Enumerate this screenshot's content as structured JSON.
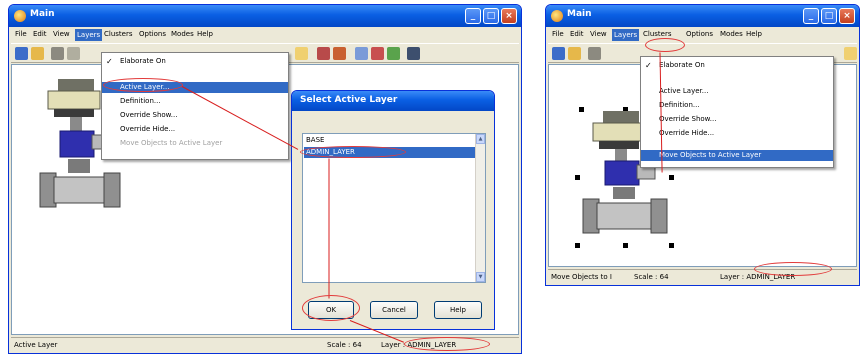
{
  "left_window": {
    "title": "Main",
    "menu": [
      "File",
      "Edit",
      "View",
      "Layers",
      "Clusters",
      "Options",
      "Modes",
      "Help"
    ],
    "layers_menu": {
      "elaborate_on": "Elaborate On",
      "active_layer": "Active Layer...",
      "definition": "Definition...",
      "override_show": "Override Show...",
      "override_hide": "Override Hide...",
      "move_objects": "Move Objects to Active Layer"
    },
    "status": {
      "left": "Active Layer",
      "scale": "Scale : 64",
      "layer": "Layer : ADMIN_LAYER"
    },
    "dialog": {
      "title": "Select Active Layer",
      "items": [
        "BASE",
        "ADMIN_LAYER"
      ],
      "ok": "OK",
      "cancel": "Cancel",
      "help": "Help"
    }
  },
  "right_window": {
    "title": "Main",
    "menu": [
      "File",
      "Edit",
      "View",
      "Layers",
      "Clusters",
      "Options",
      "Modes",
      "Help"
    ],
    "layers_menu": {
      "elaborate_on": "Elaborate On",
      "active_layer": "Active Layer...",
      "definition": "Definition...",
      "override_show": "Override Show...",
      "override_hide": "Override Hide...",
      "move_objects": "Move Objects to Active Layer"
    },
    "status": {
      "left": "Move Objects to I",
      "scale": "Scale : 64",
      "layer": "Layer : ADMIN_LAYER"
    }
  },
  "colors": {
    "selection": "#316ac5",
    "title_bar": "#0a5fe3",
    "annotation": "#d81e1e"
  }
}
